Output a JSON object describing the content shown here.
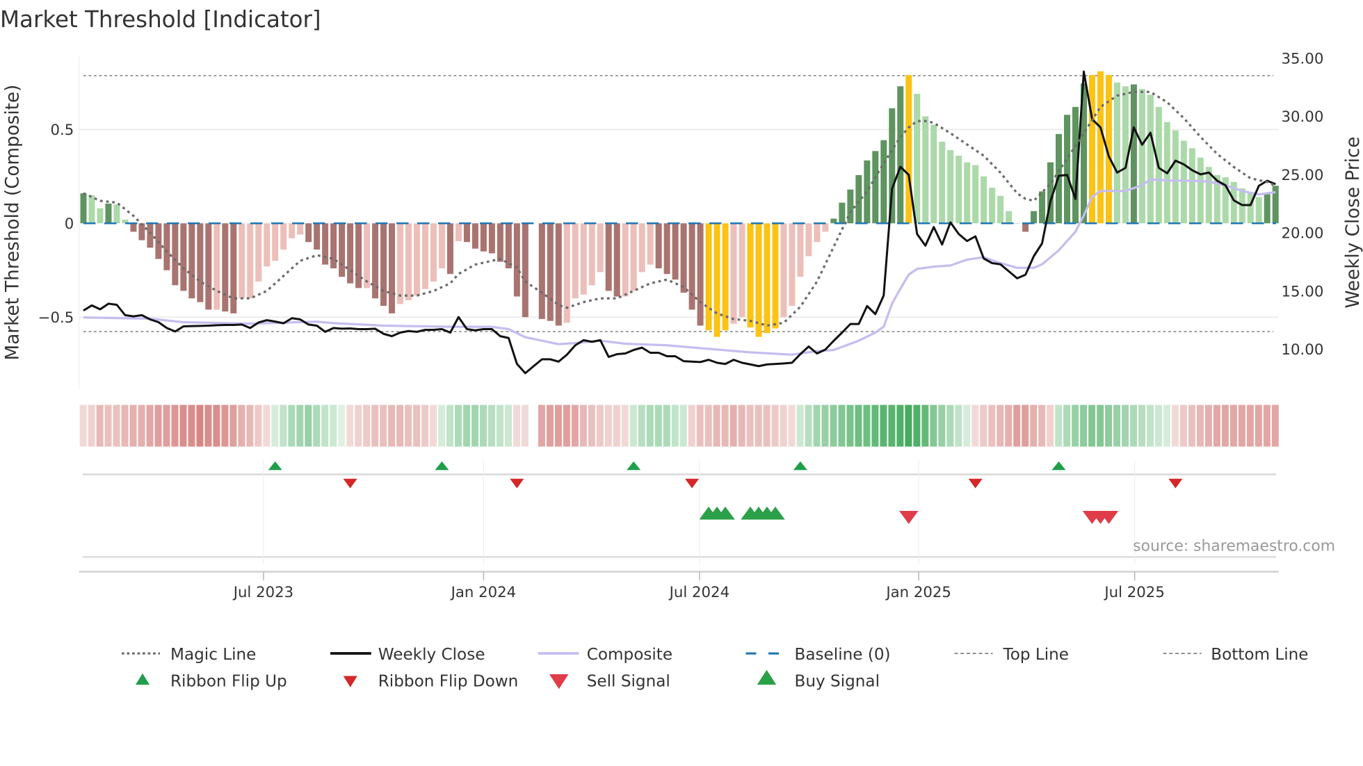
{
  "title": "Market Threshold [Indicator]",
  "source": "source: sharemaestro.com",
  "colors": {
    "up_strong": "#5f9460",
    "up_weak": "#acd9a9",
    "down_strong": "#a97470",
    "down_weak": "#ecbfba",
    "extreme": "#fcc314",
    "magic": "#6b6b6b",
    "close": "#111111",
    "composite": "#c5bdf0",
    "baseline": "#1f77b4",
    "threshold": "#888888",
    "ribbon_up": "#3aa655",
    "ribbon_down": "#d47f7c",
    "flip_up": "#1f9e4a",
    "flip_down": "#d62728",
    "buy": "#2ca048",
    "sell": "#e03c4a"
  },
  "chart_data": {
    "type": "bar+line",
    "title": "Market Threshold [Indicator]",
    "x_unit": "week index",
    "x_ticks": [
      {
        "label": "Jul 2023",
        "week": 21.6
      },
      {
        "label": "Jan 2024",
        "week": 48.0
      },
      {
        "label": "Jul 2024",
        "week": 73.9
      },
      {
        "label": "Jan 2025",
        "week": 100.2
      },
      {
        "label": "Jul 2025",
        "week": 126.1
      }
    ],
    "left_axis": {
      "label": "Market Threshold (Composite)",
      "ylim": [
        -0.88,
        0.89
      ],
      "ticks": [
        {
          "v": 0.5,
          "label": "0.5"
        },
        {
          "v": 0,
          "label": "0"
        },
        {
          "v": -0.5,
          "label": "−0.5"
        }
      ],
      "gridlines": [
        0.5,
        -0.5
      ]
    },
    "right_axis": {
      "label": "Weekly Close Price",
      "ylim": [
        6.5,
        35.1
      ],
      "ticks": [
        {
          "v": 35,
          "label": "35.00"
        },
        {
          "v": 30,
          "label": "30.00"
        },
        {
          "v": 25,
          "label": "25.00"
        },
        {
          "v": 20,
          "label": "20.00"
        },
        {
          "v": 15,
          "label": "15.00"
        },
        {
          "v": 10,
          "label": "10.00"
        }
      ]
    },
    "top_line": 0.787,
    "bottom_line": -0.577,
    "baseline": 0,
    "histogram": [
      0.16,
      0.15,
      0.08,
      0.105,
      0.1,
      0.02,
      -0.045,
      -0.09,
      -0.13,
      -0.19,
      -0.25,
      -0.33,
      -0.36,
      -0.4,
      -0.42,
      -0.46,
      -0.46,
      -0.47,
      -0.48,
      -0.4,
      -0.4,
      -0.31,
      -0.23,
      -0.2,
      -0.14,
      -0.08,
      -0.06,
      -0.1,
      -0.14,
      -0.22,
      -0.24,
      -0.285,
      -0.32,
      -0.345,
      -0.345,
      -0.4,
      -0.44,
      -0.48,
      -0.43,
      -0.41,
      -0.385,
      -0.35,
      -0.31,
      -0.24,
      -0.27,
      -0.095,
      -0.1,
      -0.135,
      -0.15,
      -0.16,
      -0.205,
      -0.24,
      -0.39,
      -0.5,
      null,
      -0.51,
      -0.52,
      -0.545,
      -0.53,
      -0.4,
      -0.38,
      -0.33,
      -0.26,
      -0.36,
      -0.39,
      -0.39,
      -0.36,
      -0.26,
      -0.22,
      -0.24,
      -0.27,
      -0.3,
      -0.37,
      -0.46,
      -0.545,
      -0.57,
      -0.605,
      -0.57,
      -0.535,
      -0.5,
      -0.555,
      -0.605,
      -0.585,
      -0.56,
      -0.5,
      -0.44,
      -0.285,
      -0.175,
      -0.1,
      -0.045,
      0.025,
      0.11,
      0.18,
      0.257,
      0.335,
      0.385,
      0.443,
      0.613,
      0.73,
      0.79,
      0.69,
      0.57,
      0.525,
      0.435,
      0.39,
      0.36,
      0.325,
      0.31,
      0.25,
      0.19,
      0.146,
      0.065,
      0,
      -0.045,
      0.065,
      0.17,
      0.325,
      0.476,
      0.578,
      0.62,
      0.745,
      0.79,
      0.81,
      0.79,
      0.75,
      0.73,
      0.74,
      0.715,
      0.685,
      0.62,
      0.54,
      0.495,
      0.44,
      0.4,
      0.35,
      0.3,
      0.257,
      0.245,
      0.22,
      0.186,
      0.165,
      0.14,
      0.155,
      0.2
    ],
    "extreme_weeks": [
      75,
      76,
      77,
      80,
      81,
      82,
      83,
      99,
      121,
      122,
      123
    ],
    "magic_line": [
      [
        0,
        0.16
      ],
      [
        2,
        0.12
      ],
      [
        4,
        0.11
      ],
      [
        6,
        0.04
      ],
      [
        8,
        -0.05
      ],
      [
        10,
        -0.15
      ],
      [
        12,
        -0.24
      ],
      [
        14,
        -0.31
      ],
      [
        16,
        -0.36
      ],
      [
        18,
        -0.4
      ],
      [
        20,
        -0.4
      ],
      [
        22,
        -0.36
      ],
      [
        24,
        -0.28
      ],
      [
        26,
        -0.2
      ],
      [
        28,
        -0.17
      ],
      [
        30,
        -0.19
      ],
      [
        32,
        -0.25
      ],
      [
        34,
        -0.31
      ],
      [
        36,
        -0.36
      ],
      [
        38,
        -0.385
      ],
      [
        40,
        -0.385
      ],
      [
        42,
        -0.36
      ],
      [
        44,
        -0.32
      ],
      [
        45,
        -0.27
      ],
      [
        47,
        -0.22
      ],
      [
        50,
        -0.19
      ],
      [
        52,
        -0.235
      ],
      [
        53,
        -0.31
      ],
      [
        55,
        -0.37
      ],
      [
        57,
        -0.435
      ],
      [
        58,
        -0.45
      ],
      [
        60,
        -0.42
      ],
      [
        62,
        -0.4
      ],
      [
        64,
        -0.4
      ],
      [
        66,
        -0.36
      ],
      [
        68,
        -0.32
      ],
      [
        70,
        -0.3
      ],
      [
        72,
        -0.34
      ],
      [
        74,
        -0.42
      ],
      [
        76,
        -0.48
      ],
      [
        78,
        -0.51
      ],
      [
        80,
        -0.52
      ],
      [
        82,
        -0.545
      ],
      [
        84,
        -0.53
      ],
      [
        86,
        -0.445
      ],
      [
        88,
        -0.31
      ],
      [
        90,
        -0.125
      ],
      [
        92,
        0.06
      ],
      [
        94,
        0.17
      ],
      [
        96,
        0.32
      ],
      [
        98,
        0.46
      ],
      [
        99,
        0.51
      ],
      [
        100,
        0.545
      ],
      [
        101,
        0.545
      ],
      [
        102,
        0.535
      ],
      [
        104,
        0.48
      ],
      [
        106,
        0.42
      ],
      [
        108,
        0.36
      ],
      [
        110,
        0.27
      ],
      [
        112,
        0.16
      ],
      [
        113,
        0.13
      ],
      [
        114,
        0.12
      ],
      [
        116,
        0.21
      ],
      [
        118,
        0.345
      ],
      [
        120,
        0.48
      ],
      [
        122,
        0.62
      ],
      [
        124,
        0.68
      ],
      [
        126,
        0.7
      ],
      [
        128,
        0.7
      ],
      [
        130,
        0.645
      ],
      [
        132,
        0.56
      ],
      [
        134,
        0.46
      ],
      [
        136,
        0.37
      ],
      [
        138,
        0.3
      ],
      [
        140,
        0.24
      ],
      [
        142,
        0.22
      ],
      [
        143,
        0.2
      ]
    ],
    "weekly_close": [
      13.33,
      13.77,
      13.43,
      13.92,
      13.82,
      12.93,
      12.83,
      12.93,
      12.57,
      12.33,
      11.83,
      11.53,
      11.97,
      11.99,
      12.01,
      12.03,
      12.07,
      12.09,
      12.09,
      12.13,
      11.83,
      12.3,
      12.5,
      12.38,
      12.23,
      12.67,
      12.57,
      12.13,
      12.03,
      11.5,
      11.83,
      11.77,
      11.79,
      11.73,
      11.73,
      11.77,
      11.33,
      11.13,
      11.43,
      11.57,
      11.5,
      11.67,
      11.67,
      11.73,
      11.43,
      12.77,
      11.73,
      11.63,
      11.73,
      11.73,
      11.13,
      10.97,
      8.75,
      7.95,
      8.55,
      9.14,
      9.14,
      8.94,
      9.54,
      10.34,
      10.78,
      10.64,
      10.78,
      9.34,
      9.58,
      9.64,
      9.94,
      10.14,
      9.7,
      9.7,
      9.4,
      9.4,
      8.98,
      8.94,
      8.9,
      9.1,
      8.84,
      8.74,
      9.1,
      8.84,
      8.7,
      8.55,
      8.7,
      8.74,
      8.78,
      8.84,
      9.58,
      10.24,
      9.64,
      9.98,
      10.73,
      11.43,
      12.17,
      12.17,
      13.72,
      13.02,
      14.62,
      23.78,
      25.68,
      24.98,
      19.9,
      18.9,
      20.5,
      19.0,
      20.9,
      19.9,
      19.3,
      19.7,
      17.8,
      17.4,
      17.3,
      16.7,
      16.1,
      16.4,
      18.0,
      19.1,
      22.7,
      24.9,
      24.98,
      22.9,
      33.85,
      29.76,
      29.06,
      26.57,
      25.18,
      25.58,
      29.06,
      27.57,
      28.6,
      25.58,
      25.12,
      26.2,
      25.88,
      25.38,
      25.02,
      25.18,
      24.48,
      24.08,
      22.79,
      22.39,
      22.39,
      24.04,
      24.48,
      24.18
    ],
    "composite": [
      [
        0,
        12.73
      ],
      [
        8,
        12.63
      ],
      [
        12,
        12.33
      ],
      [
        20,
        12.2
      ],
      [
        28,
        12.37
      ],
      [
        30,
        12.25
      ],
      [
        36,
        12.03
      ],
      [
        44,
        11.93
      ],
      [
        49,
        11.93
      ],
      [
        51,
        11.73
      ],
      [
        53,
        11.04
      ],
      [
        57,
        10.44
      ],
      [
        59,
        10.54
      ],
      [
        62,
        10.74
      ],
      [
        65,
        10.48
      ],
      [
        70,
        10.34
      ],
      [
        75,
        10.04
      ],
      [
        80,
        9.74
      ],
      [
        85,
        9.54
      ],
      [
        88,
        9.84
      ],
      [
        90,
        9.94
      ],
      [
        93,
        10.74
      ],
      [
        95,
        11.43
      ],
      [
        96,
        11.93
      ],
      [
        97,
        13.92
      ],
      [
        98,
        15.2
      ],
      [
        99,
        16.41
      ],
      [
        100,
        16.9
      ],
      [
        102,
        17.1
      ],
      [
        104,
        17.2
      ],
      [
        106,
        17.7
      ],
      [
        108,
        17.9
      ],
      [
        110,
        17.4
      ],
      [
        112,
        17.0
      ],
      [
        114,
        17.0
      ],
      [
        115,
        17.3
      ],
      [
        117,
        18.5
      ],
      [
        119,
        20.1
      ],
      [
        120,
        21.5
      ],
      [
        121,
        23.1
      ],
      [
        122,
        23.6
      ],
      [
        125,
        23.6
      ],
      [
        127,
        24.1
      ],
      [
        128,
        24.6
      ],
      [
        130,
        24.5
      ],
      [
        133,
        24.48
      ],
      [
        135,
        24.4
      ],
      [
        137,
        24.1
      ],
      [
        139,
        23.6
      ],
      [
        141,
        23.3
      ],
      [
        143,
        23.5
      ]
    ],
    "ribbon": [
      -0.15,
      -0.2,
      -0.35,
      -0.3,
      -0.3,
      -0.35,
      -0.4,
      -0.4,
      -0.45,
      -0.5,
      -0.5,
      -0.55,
      -0.6,
      -0.6,
      -0.65,
      -0.6,
      -0.6,
      -0.55,
      -0.5,
      -0.4,
      -0.35,
      -0.25,
      -0.15,
      0.2,
      0.3,
      0.4,
      0.45,
      0.5,
      0.4,
      0.3,
      0.25,
      0.15,
      -0.15,
      -0.2,
      -0.25,
      -0.3,
      -0.3,
      -0.35,
      -0.35,
      -0.3,
      -0.3,
      -0.25,
      -0.15,
      0.2,
      0.3,
      0.4,
      0.45,
      0.45,
      0.4,
      0.35,
      0.3,
      0.25,
      -0.15,
      -0.15,
      null,
      -0.45,
      -0.5,
      -0.5,
      -0.5,
      -0.45,
      -0.35,
      -0.3,
      -0.25,
      -0.2,
      -0.2,
      -0.15,
      0.25,
      0.35,
      0.4,
      0.4,
      0.4,
      0.3,
      0.25,
      -0.2,
      -0.3,
      -0.3,
      -0.35,
      -0.35,
      -0.4,
      -0.35,
      -0.3,
      -0.3,
      -0.3,
      -0.25,
      -0.2,
      -0.15,
      0.25,
      0.35,
      0.45,
      0.5,
      0.55,
      0.6,
      0.65,
      0.7,
      0.7,
      0.75,
      0.8,
      0.8,
      0.85,
      0.9,
      0.85,
      0.75,
      0.6,
      0.5,
      0.4,
      0.3,
      0.2,
      -0.15,
      -0.25,
      -0.3,
      -0.35,
      -0.4,
      -0.5,
      -0.5,
      -0.4,
      -0.35,
      -0.2,
      0.3,
      0.4,
      0.5,
      0.55,
      0.6,
      0.6,
      0.55,
      0.5,
      0.45,
      0.4,
      0.35,
      0.3,
      0.25,
      0.2,
      -0.15,
      -0.25,
      -0.3,
      -0.35,
      -0.4,
      -0.45,
      -0.45,
      -0.45,
      -0.45,
      -0.45,
      -0.45,
      -0.45,
      -0.45
    ],
    "ribbon_flip_up": [
      23,
      43,
      66,
      86,
      117
    ],
    "ribbon_flip_down": [
      32,
      52,
      73,
      107,
      131
    ],
    "buy_signals": [
      75,
      76,
      77,
      80,
      81,
      82,
      83
    ],
    "sell_signals": [
      99,
      121,
      122,
      123
    ],
    "legend": {
      "placement": "bottom",
      "magic": "Magic Line",
      "close": "Weekly Close",
      "composite": "Composite",
      "baseline": "Baseline (0)",
      "top": "Top Line",
      "bottom": "Bottom Line",
      "flip_up": "Ribbon Flip Up",
      "flip_down": "Ribbon Flip Down",
      "sell": "Sell Signal",
      "buy": "Buy Signal"
    }
  }
}
